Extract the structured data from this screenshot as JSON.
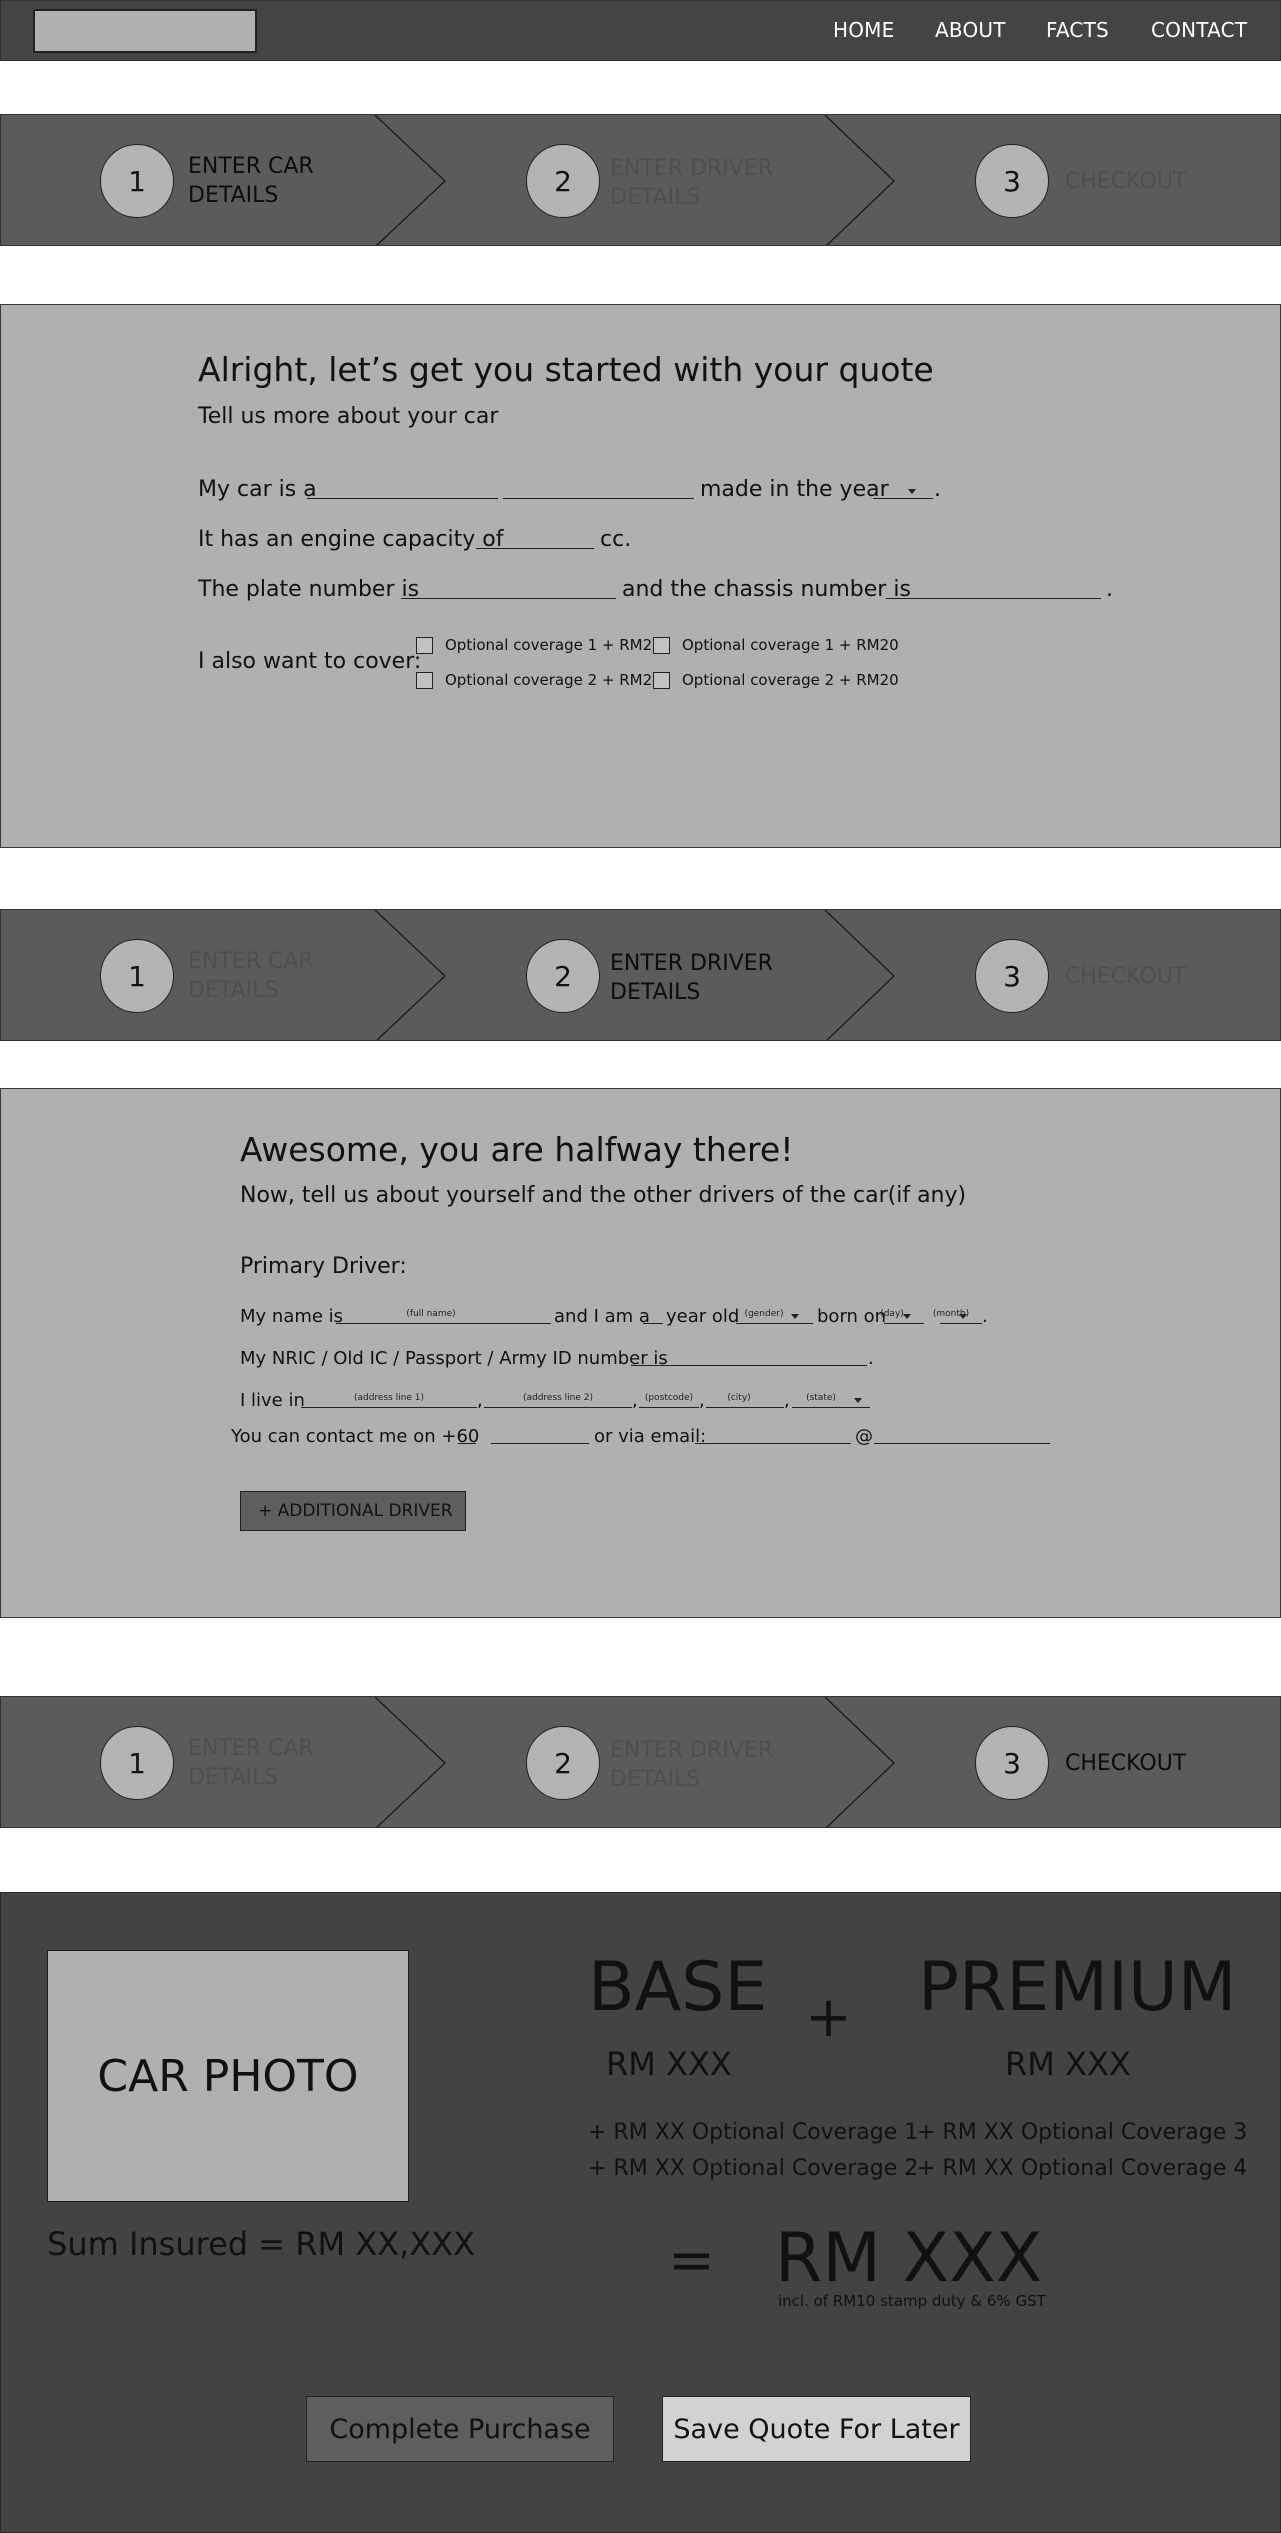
{
  "nav": {
    "links": [
      "HOME",
      "ABOUT",
      "FACTS",
      "CONTACT"
    ]
  },
  "steps": [
    {
      "number": "1",
      "label_line1": "ENTER CAR",
      "label_line2": "DETAILS"
    },
    {
      "number": "2",
      "label_line1": "ENTER DRIVER",
      "label_line2": "DETAILS"
    },
    {
      "number": "3",
      "label_line1": "CHECKOUT",
      "label_line2": ""
    }
  ],
  "car_form": {
    "title": "Alright, let’s get you started with your quote",
    "subtitle": "Tell us more about your car",
    "line1_prefix": "My car is a",
    "line1_mid": "made in the year",
    "line1_end": ".",
    "line2_prefix": "It has an engine capacity of",
    "line2_suffix": "cc.",
    "line3_prefix": "The plate number is",
    "line3_mid": "and the chassis number is",
    "line3_end": ".",
    "cover_label": "I also want to cover:",
    "coverages": [
      "Optional coverage 1 + RM20",
      "Optional coverage 1 + RM20",
      "Optional coverage 2 + RM20",
      "Optional coverage 2 + RM20"
    ]
  },
  "driver_form": {
    "title": "Awesome, you are halfway there!",
    "subtitle": "Now, tell us about yourself and the other drivers of the car(if any)",
    "primary_label": "Primary Driver:",
    "name_prefix": "My name is",
    "name_hint": "(full name)",
    "name_mid": "and I am a",
    "age_suffix": "year old",
    "gender_hint": "(gender)",
    "born_label": "born on",
    "day_hint": "(day)",
    "month_hint": "(month)",
    "name_end": ".",
    "id_prefix": "My NRIC / Old IC / Passport / Army ID  number is",
    "id_end": ".",
    "live_prefix": "I live in",
    "address1_hint": "(address line 1)",
    "address2_hint": "(address line 2)",
    "postcode_hint": "(postcode)",
    "city_hint": "(city)",
    "state_hint": "(state)",
    "comma": ",",
    "contact_prefix": "You can contact me on +60",
    "contact_mid": "or via email:",
    "at_sign": "@",
    "add_driver_label": "+ ADDITIONAL DRIVER"
  },
  "checkout": {
    "photo_label": "CAR PHOTO",
    "sum_insured": "Sum Insured = RM XX,XXX",
    "base_label": "BASE",
    "base_amount": "RM XXX",
    "plus": "+",
    "premium_label": "PREMIUM",
    "premium_amount": "RM XXX",
    "coverages_left": [
      "+ RM XX Optional Coverage 1",
      "+ RM XX Optional Coverage 2"
    ],
    "coverages_right": [
      "+ RM XX Optional Coverage 3",
      "+ RM XX Optional Coverage 4"
    ],
    "equals": "=",
    "total_amount": "RM XXX",
    "total_note": "incl. of RM10 stamp duty & 6% GST",
    "complete_label": "Complete Purchase",
    "save_label": "Save Quote For Later"
  }
}
